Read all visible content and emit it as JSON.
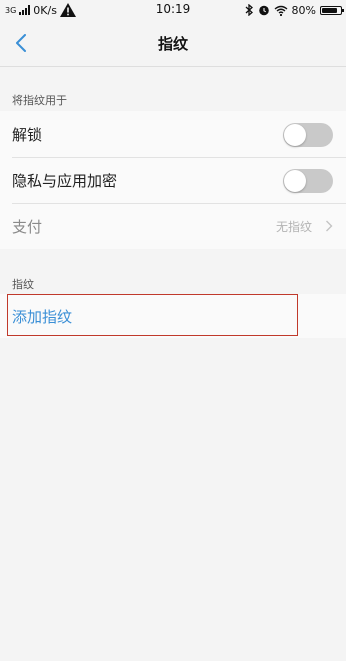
{
  "status_bar": {
    "network": "3G",
    "speed": "0K/s",
    "time": "10:19",
    "battery": "80%"
  },
  "nav": {
    "title": "指纹"
  },
  "sections": {
    "usage_header": "将指纹用于",
    "unlock_label": "解锁",
    "unlock_toggle": "off",
    "privacy_label": "隐私与应用加密",
    "privacy_toggle": "off",
    "payment_label": "支付",
    "payment_value": "无指纹",
    "fingerprint_header": "指纹",
    "add_fingerprint": "添加指纹"
  },
  "colors": {
    "accent": "#3a8fd6",
    "highlight": "#c0392b"
  }
}
